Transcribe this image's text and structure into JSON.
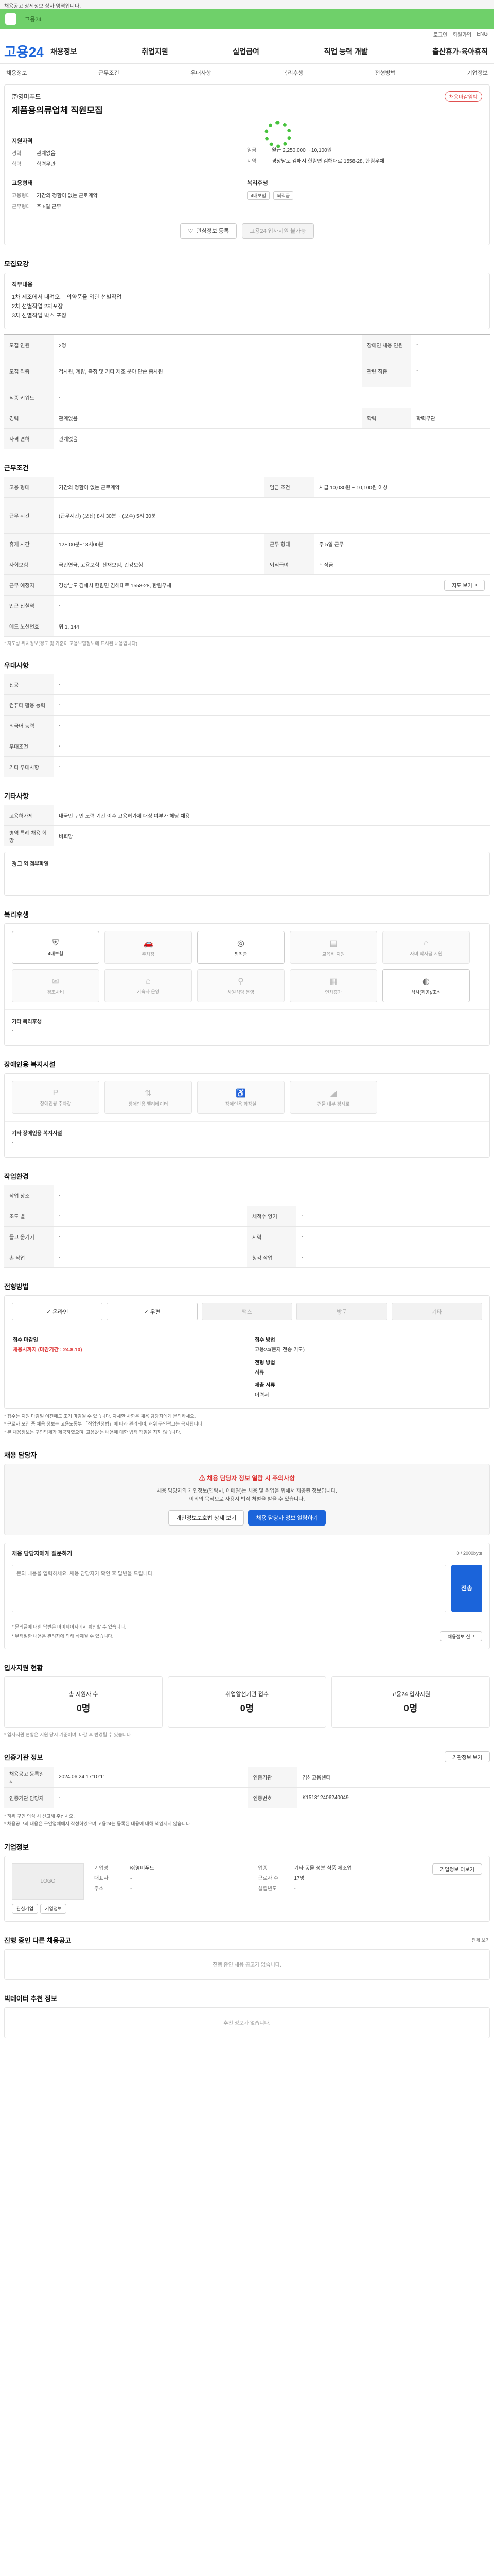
{
  "notice": "채용공고 상세정보 상자 영역입니다.",
  "topbar": {
    "text": "고용24"
  },
  "util": [
    "로그인",
    "회원가입",
    "ENG"
  ],
  "gnb": {
    "logo": "고용24",
    "menu": [
      "채용정보",
      "취업지원",
      "실업급여",
      "직업 능력 개발",
      "출산휴가·육아휴직"
    ]
  },
  "subnav": [
    "채용정보",
    "근무조건",
    "우대사항",
    "복리후생",
    "전형방법",
    "기업정보"
  ],
  "summary": {
    "company": "㈜영미푸드",
    "title": "제품용의류업체 직원모집",
    "badge": "채용마감임박",
    "left_title": "지원자격",
    "left_rows": [
      {
        "k": "경력",
        "v": "관계없음"
      },
      {
        "k": "학력",
        "v": "학력무관"
      }
    ],
    "right_rows": [
      {
        "k": "임금",
        "v": "월급 2,250,000 ~ 10,100원"
      },
      {
        "k": "지역",
        "v": "경상남도 김해시 한림면 김해대로 1558-28, 한림우체"
      }
    ],
    "left2_title": "고용형태",
    "left2_rows": [
      {
        "k": "고용형태",
        "v": "기간의 정함이 없는 근로계약"
      },
      {
        "k": "근무형태",
        "v": "주 5일 근무"
      }
    ],
    "right2_title": "복리후생",
    "tags": [
      "4대보험",
      "퇴직금"
    ],
    "btn_scrap": "관심정보 등록",
    "btn_apply": "고용24 입사지원 불가능"
  },
  "recruit": {
    "title": "모집요강",
    "box_title": "직무내용",
    "box_lines": [
      "1차 제조에서 내려오는 의약품을 외관 선별작업",
      "2차 선별작업 2차포장",
      "3차 선별작업 박스 포장"
    ],
    "rows": [
      [
        "모집 인원",
        "2명",
        "장애인 채용 인원",
        "-"
      ],
      [
        "모집 직종",
        "검사원, 계량, 측정 및 기타 제조 분야 단순 종사원",
        "관련 직종",
        "-"
      ],
      [
        "직종 키워드",
        "-",
        "",
        ""
      ],
      [
        "경력",
        "관계없음",
        "학력",
        "학력무관"
      ],
      [
        "자격 면허",
        "관계없음",
        "",
        ""
      ]
    ]
  },
  "cond": {
    "title": "근무조건",
    "rows": [
      [
        "고용 형태",
        "기간의 정함이 없는 근로계약",
        "임금 조건",
        "시급 10,030원 ~ 10,100원 이상"
      ],
      [
        "근무 시간",
        "(근무시간) (오전) 8시 30분 ~ (오후) 5시 30분",
        "",
        ""
      ],
      [
        "휴게 시간",
        "12시00분~13시00분",
        "근무 형태",
        "주 5일 근무"
      ],
      [
        "사회보험",
        "국민연금, 고용보험, 산재보험, 건강보험",
        "퇴직급여",
        "퇴직금"
      ],
      [
        "근무 예정지",
        "경상남도 김해시 한림면 김해대로 1558-28, 한림우체",
        "",
        ""
      ],
      [
        "인근 전철역",
        "-",
        "",
        ""
      ],
      [
        "에드 노선번호",
        "위 1, 144",
        "",
        ""
      ]
    ],
    "map_btn": "지도 보기",
    "note": "* 지도상 위치정보(경도 및 기준이 고용보험정보에 표시된 내용입니다)"
  },
  "pref": {
    "title": "우대사항",
    "rows": [
      [
        "전공",
        "-"
      ],
      [
        "컴퓨터 활용 능력",
        "-"
      ],
      [
        "외국어 능력",
        "-"
      ],
      [
        "우대조건",
        "-"
      ],
      [
        "기타 우대사항",
        "-"
      ]
    ]
  },
  "other": {
    "title": "기타사항",
    "rows": [
      [
        "고용허가제",
        "내국인 구인 노력 기간 이후 고용허가제 대상 여부가 해당 채용"
      ],
      [
        "병역 특례 채용 희망",
        "비희망"
      ]
    ],
    "sub": "그 외 첨부파일"
  },
  "welfare": {
    "title": "복리후생",
    "items": [
      {
        "label": "4대보험",
        "icon": "shield-icon",
        "on": true
      },
      {
        "label": "주차장",
        "icon": "car-icon",
        "on": false
      },
      {
        "label": "퇴직금",
        "icon": "coin-icon",
        "on": true
      },
      {
        "label": "교육비 지원",
        "icon": "book-icon",
        "on": false
      },
      {
        "label": "자녀 학자금 지원",
        "icon": "cap-icon",
        "on": false
      },
      {
        "label": "경조사비",
        "icon": "gift-icon",
        "on": false
      },
      {
        "label": "기숙사 운영",
        "icon": "home-icon",
        "on": false
      },
      {
        "label": "사원식당 운영",
        "icon": "fork-icon",
        "on": false
      },
      {
        "label": "연차휴가",
        "icon": "calendar-icon",
        "on": false
      },
      {
        "label": "식사(제공)/조식",
        "icon": "rice-icon",
        "on": true
      }
    ],
    "sub": "기타 복리후생"
  },
  "disab": {
    "title": "장애인용 복지시설",
    "items": [
      "장애인용 주차장",
      "장애인용 엘리베이터",
      "장애인용 화장실",
      "건물 내부 경사로"
    ],
    "sub": "기타 장애인용 복지시설"
  },
  "env": {
    "title": "작업환경",
    "rows": [
      [
        "작업 장소",
        "-",
        "",
        " "
      ],
      [
        "조도 별",
        "-",
        "세척수 양기",
        "-"
      ],
      [
        "들고 옮기기",
        "-",
        "시력",
        "-"
      ],
      [
        "손 작업",
        "-",
        "청각 작업",
        "-"
      ]
    ]
  },
  "method": {
    "title": "전형방법",
    "loc": [
      "온라인",
      "우편",
      "팩스",
      "방문",
      "기타"
    ],
    "loc_on": [
      true,
      true,
      false,
      false,
      false
    ],
    "c1_h": "접수 마감일",
    "c1_v": "채용시까지 (마감기간 : 24.8.10)",
    "c2_h": "접수 방법",
    "c2_v": "고용24(문자 전송 기도)",
    "c2_v2": "전형 방법",
    "c2_v3": "서류",
    "c2_v4": "제출 서류",
    "c2_v5": "이력서",
    "notes": [
      "* 접수는 지원 마감일 이전에도 조기 마감될 수 있습니다. 자세한 사항은 채용 담당자에게 문의하세요.",
      "* 근로자 모집 중 채용 정보는 고용노동부 「직업안정법」에 따라 관리되며, 허위 구인광고는 금지됩니다.",
      "* 본 채용정보는 구인업체가 제공하였으며, 고용24는 내용에 대한 법적 책임을 지지 않습니다."
    ]
  },
  "contact": {
    "title": "채용 담당자",
    "alert": "채용 담당자 정보 열람 시 주의사항",
    "p1": "채용 담당자의 개인정보(연락처, 이메일)는 채용 및 취업을 위해서 제공된 정보입니다.",
    "p2": "이외의 목적으로 사용시 법적 처벌을 받을 수 있습니다.",
    "b1": "개인정보보호법 상세 보기",
    "b2": "채용 담당자 정보 열람하기"
  },
  "inquiry": {
    "title": "채용 담당자에게 질문하기",
    "count": "0 / 2000byte",
    "placeholder": "문의 내용을 입력하세요. 채용 담당자가 확인 후 답변을 드립니다.",
    "send": "전송",
    "lines": [
      "* 문의글에 대한 답변은 마이페이지에서 확인할 수 있습니다.",
      "* 부적절한 내용은 관리자에 의해 삭제될 수 있습니다."
    ],
    "small_btn": "채용정보 신고"
  },
  "status": {
    "title": "입사지원 현황",
    "items": [
      {
        "l": "총 지원자 수",
        "n": "0명"
      },
      {
        "l": "취업알선기관 접수",
        "n": "0명"
      },
      {
        "l": "고용24 입사지원",
        "n": "0명"
      }
    ],
    "note": "* 입사지원 현황은 지원 당시 기준이며, 마감 후 변경될 수 있습니다."
  },
  "source": {
    "title": "인증기관 정보",
    "btn": "기관정보 보기",
    "rows": [
      [
        "채용공고 등록일시",
        "2024.06.24 17:10:11",
        "인증기관",
        "김해고용센터"
      ],
      [
        "인증기관 담당자",
        "-",
        "인증번호",
        "K151312406240049"
      ]
    ],
    "notes": [
      "* 허위 구인 의심 시 신고해 주십시오.",
      "* 채용공고의 내용은 구인업체에서 작성하였으며 고용24는 등록된 내용에 대해 책임지지 않습니다."
    ]
  },
  "company": {
    "title": "기업정보",
    "logo": "LOGO",
    "rows": [
      [
        "기업명",
        "㈜영미푸드",
        "업종",
        "기타 동물 성분 식품 제조업"
      ],
      [
        "대표자",
        "-",
        "근로자 수",
        "17명"
      ],
      [
        "주소",
        "-",
        "설립년도",
        "-"
      ]
    ],
    "btn": "기업정보 더보기",
    "b_small": [
      "관심기업",
      "기업정보"
    ]
  },
  "other_jobs": {
    "title": "진행 중인 다른 채용공고",
    "empty": "진행 중인 채용 공고가 없습니다.",
    "more": "전체 보기"
  },
  "recommend": {
    "title": "빅데이터 추천 정보",
    "empty": "추천 정보가 없습니다."
  }
}
